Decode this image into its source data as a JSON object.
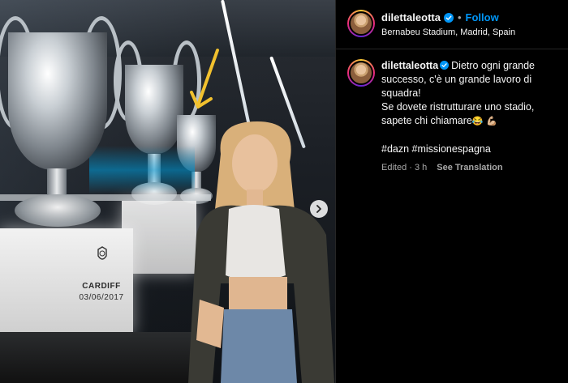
{
  "post": {
    "username": "dilettaleotta",
    "follow_label": "Follow",
    "separator": "•",
    "location": "Bernabeu Stadium, Madrid, Spain"
  },
  "caption": {
    "username": "dilettaleotta",
    "line1": "Dietro ogni grande successo, c'è un grande lavoro di squadra!",
    "line2": "Se dovete ristrutturare uno stadio, sapete chi chiamare",
    "emoji1": "😂",
    "emoji2": "💪🏼",
    "hashtags": "#dazn #missionespagna",
    "edited": "Edited · 3 h",
    "see_translation": "See Translation"
  },
  "photo": {
    "pedestal_text": "CARDIFF",
    "pedestal_date": "03/06/2017"
  },
  "colors": {
    "accent": "#0095f6",
    "arrow": "#f2c12e"
  },
  "icons": {
    "verified": "verified-badge-icon",
    "next": "chevron-right-icon"
  }
}
